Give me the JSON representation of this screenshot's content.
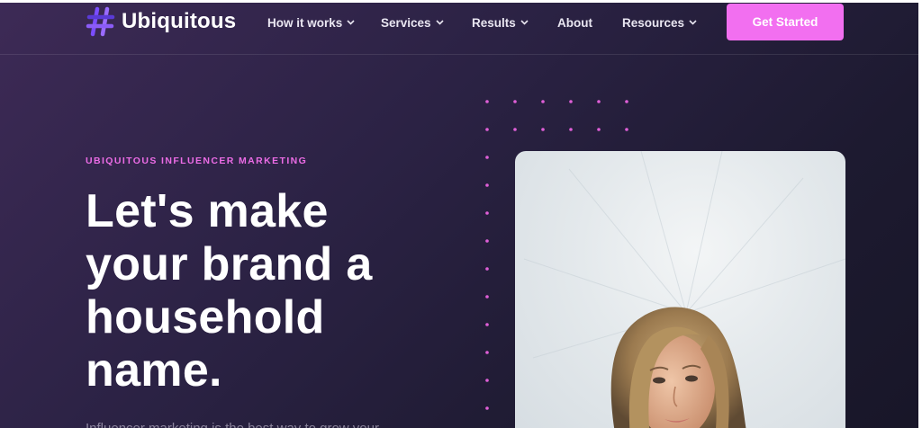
{
  "brand": {
    "name": "Ubiquitous",
    "logo_icon": "hashtag-logo-icon",
    "accent": "#f26ff0",
    "logo_color": "#7b4dff"
  },
  "nav": {
    "items": [
      {
        "label": "How it works",
        "has_dropdown": true
      },
      {
        "label": "Services",
        "has_dropdown": true
      },
      {
        "label": "Results",
        "has_dropdown": true
      },
      {
        "label": "About",
        "has_dropdown": false
      },
      {
        "label": "Resources",
        "has_dropdown": true
      }
    ],
    "cta_label": "Get Started"
  },
  "hero": {
    "eyebrow": "UBIQUITOUS INFLUENCER MARKETING",
    "headline_lines": [
      "Let's make",
      "your brand a",
      "household",
      "name."
    ],
    "subtext": "Influencer marketing is the best way to grow your"
  },
  "image": {
    "description_icon": "portrait-photo",
    "alt": "Woman with long blonde hair"
  },
  "colors": {
    "background_start": "#3d2a56",
    "background_end": "#181628",
    "eyebrow": "#ec6ce6",
    "dots": "#e05fd8"
  }
}
